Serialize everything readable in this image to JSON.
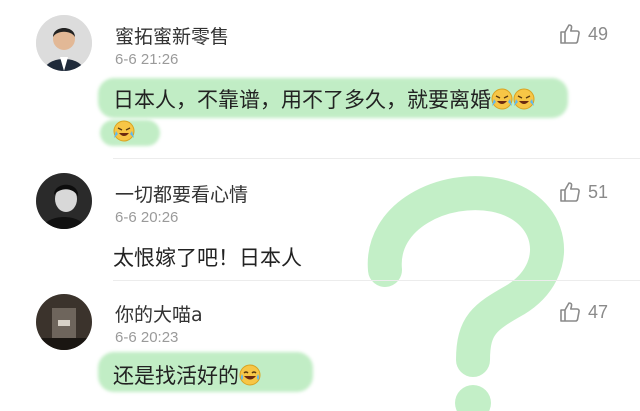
{
  "comments": [
    {
      "name": "蜜拓蜜新零售",
      "time": "6-6 21:26",
      "likes": "49",
      "text": "日本人，不靠谱，用不了多久，就要离婚",
      "emoji": "crying-laughing-emoji",
      "highlighted": true
    },
    {
      "name": "一切都要看心情",
      "time": "6-6 20:26",
      "likes": "51",
      "text": "太恨嫁了吧！日本人",
      "highlighted": false
    },
    {
      "name": "你的大喵a",
      "time": "6-6 20:23",
      "likes": "47",
      "text": "还是找活好的",
      "emoji": "tears-of-joy-emoji",
      "highlighted": true
    }
  ],
  "colors": {
    "highlight": "#8ede96",
    "question_mark": "#9fe3a6",
    "meta_gray": "#9a9a9a"
  },
  "overlay": {
    "question_mark_icon": "question-mark-overlay"
  }
}
